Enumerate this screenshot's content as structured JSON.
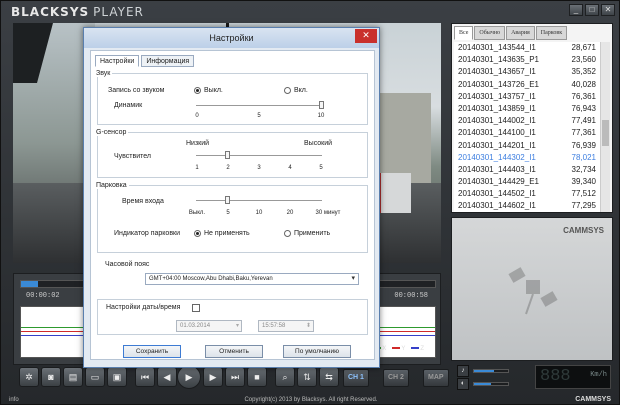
{
  "app": {
    "brand": "BLACKSYS",
    "brand_suffix": "PLAYER",
    "window_buttons": [
      "_",
      "□",
      "✕"
    ]
  },
  "timeline": {
    "time_elapsed": "00:00:02",
    "time_total": "00:00:58",
    "progress": 0.04,
    "axis_legend": [
      "X",
      "Y",
      "Z"
    ],
    "colors": {
      "x": "#2e9a2e",
      "y": "#d02a2a",
      "z": "#3640c8"
    }
  },
  "controls": {
    "ch1": "CH 1",
    "ch2": "CH 2",
    "map": "MAP"
  },
  "files": {
    "tabs": [
      "Все",
      "Обычно",
      "Авария",
      "Парковк"
    ],
    "active_tab": 0,
    "items": [
      {
        "name": "20140301_143544_I1",
        "size": "28,671"
      },
      {
        "name": "20140301_143635_P1",
        "size": "23,560"
      },
      {
        "name": "20140301_143657_I1",
        "size": "35,352"
      },
      {
        "name": "20140301_143726_E1",
        "size": "40,028"
      },
      {
        "name": "20140301_143757_I1",
        "size": "76,361"
      },
      {
        "name": "20140301_143859_I1",
        "size": "76,943"
      },
      {
        "name": "20140301_144002_I1",
        "size": "77,491"
      },
      {
        "name": "20140301_144100_I1",
        "size": "77,361"
      },
      {
        "name": "20140301_144201_I1",
        "size": "76,939"
      },
      {
        "name": "20140301_144302_I1",
        "size": "78,021"
      },
      {
        "name": "20140301_144403_I1",
        "size": "32,734"
      },
      {
        "name": "20140301_144429_E1",
        "size": "39,340"
      },
      {
        "name": "20140301_144502_I1",
        "size": "77,512"
      },
      {
        "name": "20140301_144602_I1",
        "size": "77,295"
      }
    ],
    "selected_index": 9
  },
  "map_brand": "CAMMSYS",
  "volume_level": 0.6,
  "brightness_level": 0.5,
  "speed": {
    "digits": "888",
    "unit": "Km/h"
  },
  "status": {
    "info": "info",
    "copyright": "Copyright(c) 2013 by Blacksys. All right Reserved.",
    "brand": "CAMMSYS"
  },
  "dialog": {
    "title": "Настройки",
    "close": "✕",
    "tabs": [
      "Настройки",
      "Информация"
    ],
    "active_tab": 0,
    "sound": {
      "title": "Звук",
      "record_label": "Запись со звуком",
      "off": "Выкл.",
      "on": "Вкл.",
      "selected": "off",
      "speaker_label": "Динамик",
      "speaker_ticks": [
        "0",
        "5",
        "10"
      ],
      "speaker_value": 10
    },
    "gsensor": {
      "title": "G-сенсор",
      "sensitivity_label": "Чувствител",
      "low": "Низкий",
      "high": "Высокий",
      "ticks": [
        "1",
        "2",
        "3",
        "4",
        "5"
      ],
      "value": 2
    },
    "parking": {
      "title": "Парковка",
      "entry_time_label": "Время входа",
      "ticks": [
        "Выкл.",
        "5",
        "10",
        "20",
        "30 минут"
      ],
      "value_index": 1,
      "indicator_label": "Индикатор парковки",
      "not_apply": "Не применять",
      "apply": "Применить",
      "selected": "not_apply"
    },
    "timezone": {
      "title": "Часовой пояс",
      "value": "GMT+04:00 Moscow,Abu Dhabi,Baku,Yerevan"
    },
    "datetime": {
      "title": "Настройки даты/время",
      "checked": false,
      "date": "01.03.2014",
      "time": "15:57:58"
    },
    "buttons": {
      "save": "Сохранить",
      "cancel": "Отменить",
      "default": "По умолчанию"
    }
  }
}
